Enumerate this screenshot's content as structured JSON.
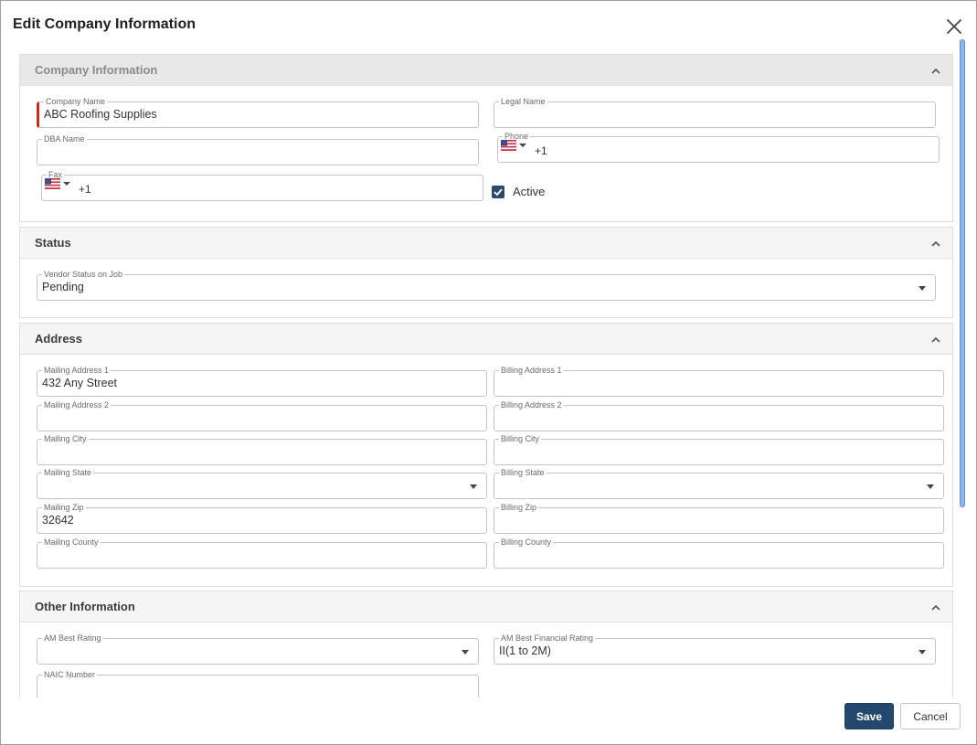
{
  "dialog": {
    "title": "Edit Company Information"
  },
  "company": {
    "title": "Company Information",
    "company_name_label": "Company Name",
    "company_name_value": "ABC Roofing Supplies",
    "legal_name_label": "Legal Name",
    "legal_name_value": "",
    "dba_name_label": "DBA Name",
    "dba_name_value": "",
    "phone_label": "Phone",
    "phone_prefix": "+1",
    "fax_label": "Fax",
    "fax_prefix": "+1",
    "active_label": "Active",
    "active_checked": true
  },
  "status": {
    "title": "Status",
    "vendor_status_label": "Vendor Status on Job",
    "vendor_status_value": "Pending"
  },
  "address": {
    "title": "Address",
    "mailing_address1_label": "Mailing Address 1",
    "mailing_address1_value": "432 Any Street",
    "billing_address1_label": "Billing Address 1",
    "mailing_address2_label": "Mailing Address 2",
    "billing_address2_label": "Billing Address 2",
    "mailing_city_label": "Mailing City",
    "billing_city_label": "Billing City",
    "mailing_state_label": "Mailing State",
    "billing_state_label": "Billing State",
    "mailing_zip_label": "Mailing Zip",
    "mailing_zip_value": "32642",
    "billing_zip_label": "Billing Zip",
    "mailing_county_label": "Mailing County",
    "billing_county_label": "Billing County"
  },
  "other": {
    "title": "Other Information",
    "am_best_rating_label": "AM Best Rating",
    "am_best_financial_label": "AM Best Financial Rating",
    "am_best_financial_value": "II(1 to 2M)",
    "naic_label": "NAIC Number"
  },
  "footer": {
    "save_label": "Save",
    "cancel_label": "Cancel"
  },
  "colors": {
    "primary": "#24476e",
    "required": "#d0281e",
    "scrollbar": "#8fb7e6"
  },
  "icons": {
    "close": "close-icon",
    "collapse": "chevron-up-icon",
    "flag": "us-flag-icon",
    "check": "checkmark-icon"
  }
}
